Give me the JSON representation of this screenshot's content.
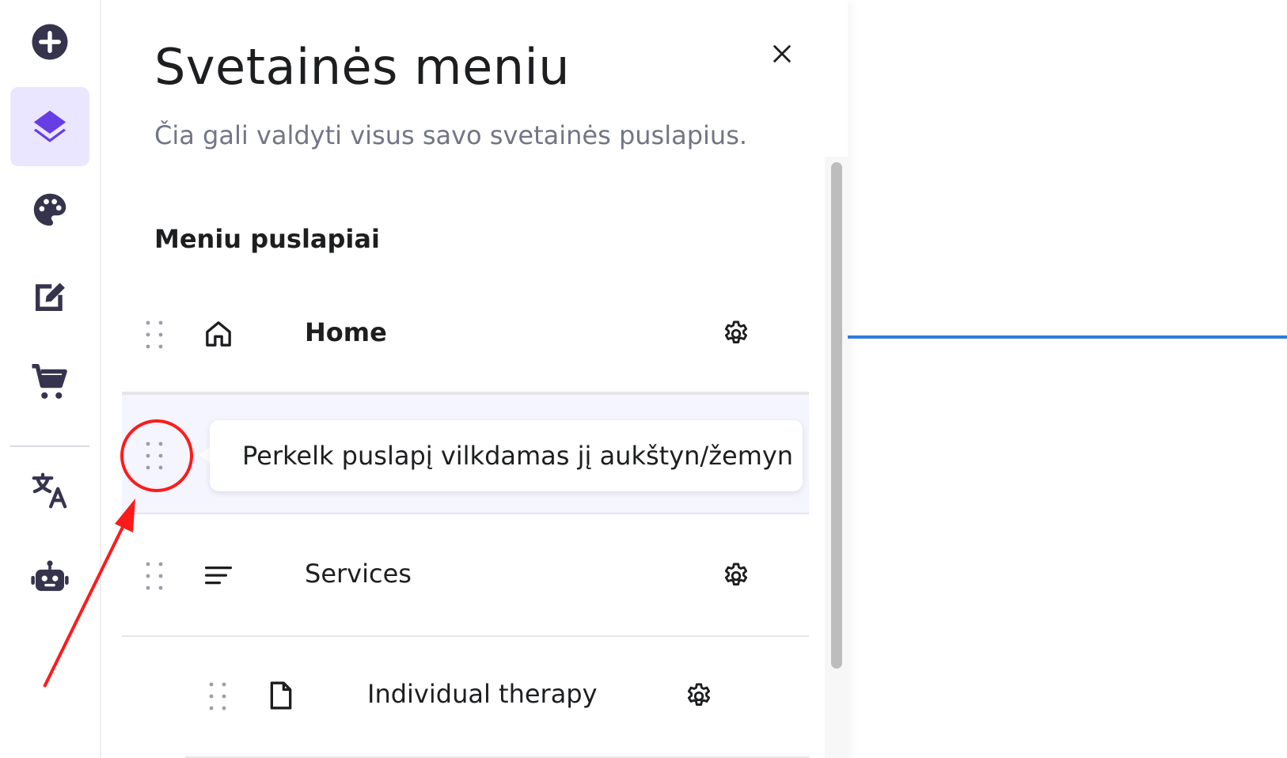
{
  "rail": {
    "items": [
      {
        "icon": "add-circle-icon",
        "active": false
      },
      {
        "icon": "layers-icon",
        "active": true
      },
      {
        "icon": "palette-icon",
        "active": false
      },
      {
        "icon": "edit-icon",
        "active": false
      },
      {
        "icon": "cart-icon",
        "active": false
      },
      {
        "icon": "translate-icon",
        "active": false
      },
      {
        "icon": "robot-icon",
        "active": false
      }
    ]
  },
  "panel": {
    "title": "Svetainės meniu",
    "subtitle": "Čia gali valdyti visus savo svetainės puslapius.",
    "section_title": "Meniu puslapiai",
    "close_icon": "close-icon",
    "tooltip": "Perkelk puslapį vilkdamas jį aukštyn/žemyn",
    "pages": [
      {
        "label": "Home",
        "icon": "home-icon",
        "bold": true
      },
      {
        "label": "Services",
        "icon": "menu-lines-icon",
        "bold": false
      },
      {
        "label": "Individual therapy",
        "icon": "file-icon",
        "bold": false
      }
    ]
  },
  "colors": {
    "accent": "#673de6",
    "accent_bg": "#ebe6ff",
    "rail_icon": "#36344d",
    "muted_text": "#727586",
    "annotation_red": "#ff1a1a",
    "preview_line": "#2e7bde"
  }
}
